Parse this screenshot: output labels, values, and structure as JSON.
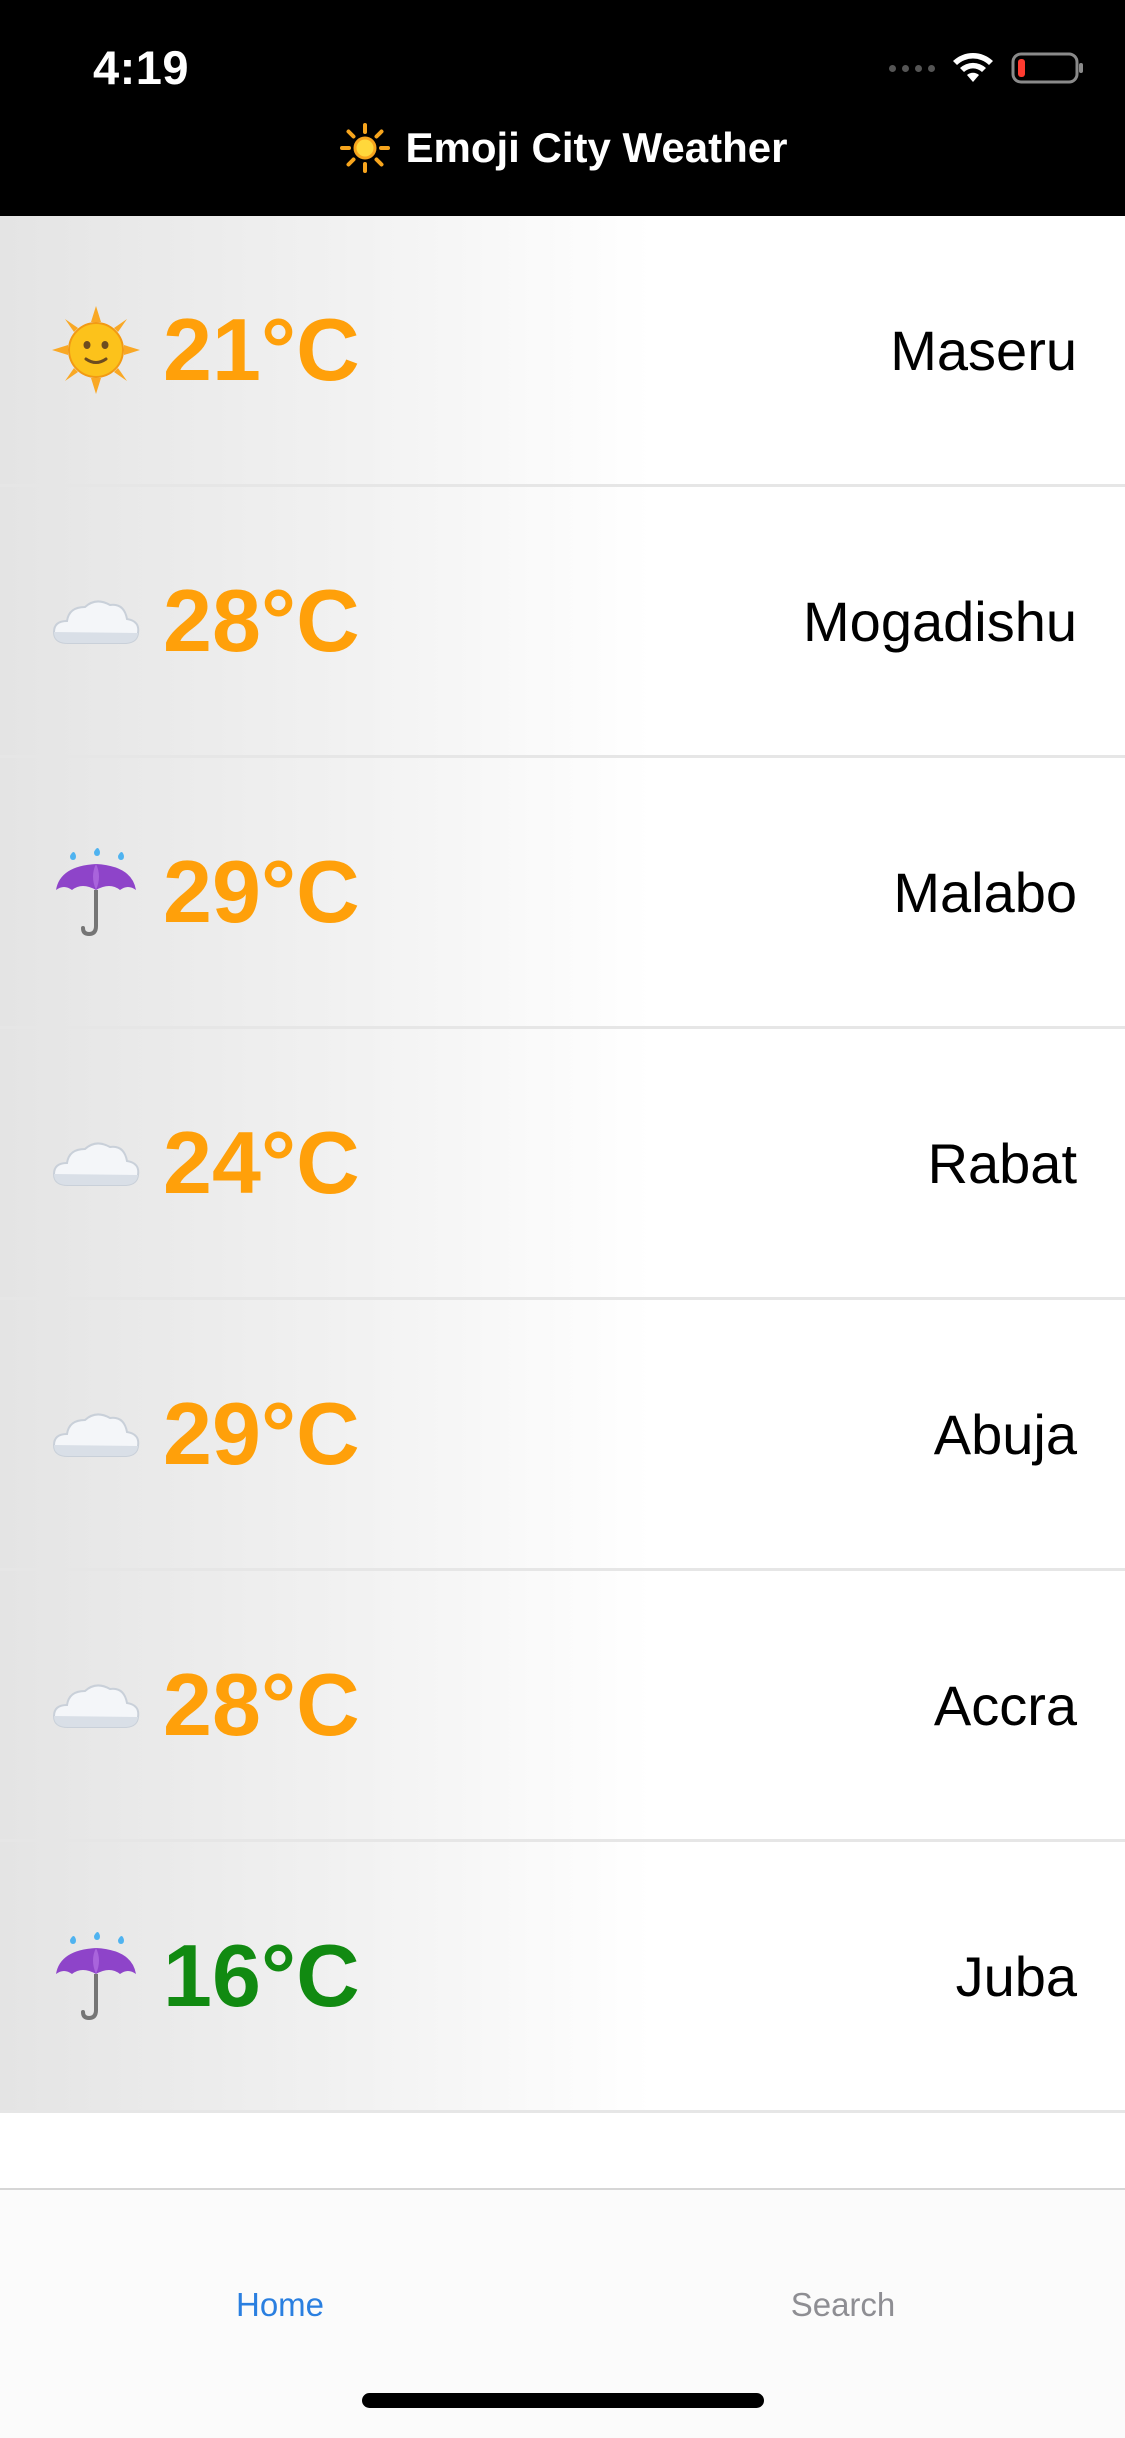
{
  "status_bar": {
    "time": "4:19",
    "icons": [
      "cellular-signal-icon",
      "wifi-icon",
      "battery-low-icon"
    ]
  },
  "header": {
    "icon": "sun-icon",
    "title": "Emoji City Weather"
  },
  "rows": [
    {
      "icon": "sun-face-icon",
      "temp": "21°C",
      "city": "Maseru"
    },
    {
      "icon": "cloud-icon",
      "temp": "28°C",
      "city": "Mogadishu"
    },
    {
      "icon": "umbrella-rain-icon",
      "temp": "29°C",
      "city": "Malabo"
    },
    {
      "icon": "cloud-icon",
      "temp": "24°C",
      "city": "Rabat"
    },
    {
      "icon": "cloud-icon",
      "temp": "29°C",
      "city": "Abuja"
    },
    {
      "icon": "cloud-icon",
      "temp": "28°C",
      "city": "Accra"
    },
    {
      "icon": "umbrella-rain-icon",
      "temp": "16°C",
      "city": "Juba"
    }
  ],
  "colors": {
    "warm_temp": "#ffa00a",
    "cool_temp": "#118a11",
    "active_tab": "#2a7fe0",
    "inactive_tab": "#8e8e93",
    "header_bg": "#000000"
  },
  "tabbar": {
    "home_label": "Home",
    "search_label": "Search",
    "active": "Home"
  }
}
